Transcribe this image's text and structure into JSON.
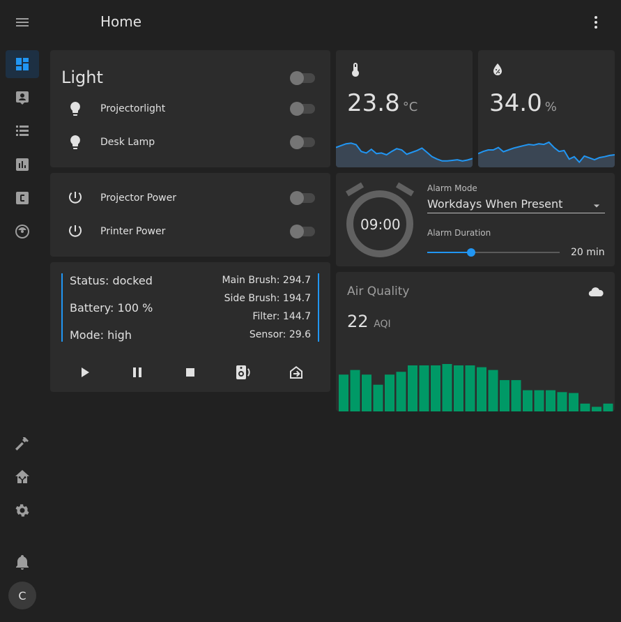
{
  "header": {
    "title": "Home"
  },
  "sidebar": {
    "items": [
      {
        "name": "overview",
        "icon": "dashboard-icon",
        "active": true
      },
      {
        "name": "map",
        "icon": "account-box-icon"
      },
      {
        "name": "logbook",
        "icon": "format-list-icon"
      },
      {
        "name": "history",
        "icon": "chart-box-icon"
      },
      {
        "name": "hacs",
        "icon": "alpha-c-box-icon"
      },
      {
        "name": "robot",
        "icon": "robot-vacuum-icon"
      }
    ],
    "bottom_items": [
      {
        "name": "developer-tools",
        "icon": "hammer-icon"
      },
      {
        "name": "supervisor",
        "icon": "home-assistant-icon"
      },
      {
        "name": "settings",
        "icon": "cog-icon"
      },
      {
        "name": "notifications",
        "icon": "bell-icon"
      }
    ],
    "user_initial": "C"
  },
  "light_card": {
    "title": "Light",
    "items": [
      {
        "label": "Projectorlight",
        "icon": "lightbulb-icon",
        "on": false
      },
      {
        "label": "Desk Lamp",
        "icon": "lightbulb-icon",
        "on": false
      }
    ]
  },
  "power_card": {
    "items": [
      {
        "label": "Projector Power",
        "icon": "power-icon",
        "on": false
      },
      {
        "label": "Printer Power",
        "icon": "power-icon",
        "on": false
      }
    ]
  },
  "temperature": {
    "value": "23.8",
    "unit": "°C",
    "icon": "thermometer-icon",
    "sparkline": [
      0.42,
      0.36,
      0.3,
      0.28,
      0.33,
      0.55,
      0.6,
      0.48,
      0.62,
      0.6,
      0.66,
      0.55,
      0.46,
      0.5,
      0.64,
      0.58,
      0.52,
      0.44,
      0.58,
      0.72,
      0.8,
      0.86,
      0.86,
      0.84,
      0.82,
      0.86,
      0.83,
      0.78
    ]
  },
  "humidity": {
    "value": "34.0",
    "unit": "%",
    "icon": "water-percent-icon",
    "sparkline": [
      0.62,
      0.55,
      0.5,
      0.5,
      0.42,
      0.56,
      0.5,
      0.44,
      0.4,
      0.36,
      0.32,
      0.34,
      0.3,
      0.32,
      0.25,
      0.42,
      0.55,
      0.52,
      0.8,
      0.72,
      0.9,
      0.7,
      0.76,
      0.82,
      0.75,
      0.72,
      0.68,
      0.66
    ]
  },
  "alarm": {
    "time": "09:00",
    "icon": "alarm-clock-icon",
    "mode_label": "Alarm Mode",
    "mode_value": "Workdays When Present",
    "duration_label": "Alarm Duration",
    "duration_value": "20 min",
    "duration_fraction": 0.33,
    "accent": "#2196f3"
  },
  "vacuum": {
    "status": "Status: docked",
    "battery": "Battery: 100 %",
    "mode": "Mode: high",
    "main_brush": "Main Brush: 294.7",
    "side_brush": "Side Brush: 194.7",
    "filter": "Filter: 144.7",
    "sensor": "Sensor: 29.6",
    "buttons": [
      "play-icon",
      "pause-icon",
      "stop-icon",
      "locate-speaker-icon",
      "return-home-icon"
    ]
  },
  "air_quality": {
    "title": "Air Quality",
    "value": "22",
    "unit": "AQI",
    "icon": "cloud-icon",
    "bar_color": "#009966",
    "bars": [
      0.8,
      0.9,
      0.8,
      0.58,
      0.8,
      0.86,
      1.0,
      1.0,
      1.0,
      1.03,
      1.0,
      1.0,
      0.96,
      0.9,
      0.68,
      0.68,
      0.46,
      0.46,
      0.46,
      0.42,
      0.4,
      0.17,
      0.1,
      0.17
    ]
  },
  "colors": {
    "line": "#2196f3",
    "fill": "#3a4654",
    "card": "#2c2c2c",
    "background": "#212121"
  }
}
